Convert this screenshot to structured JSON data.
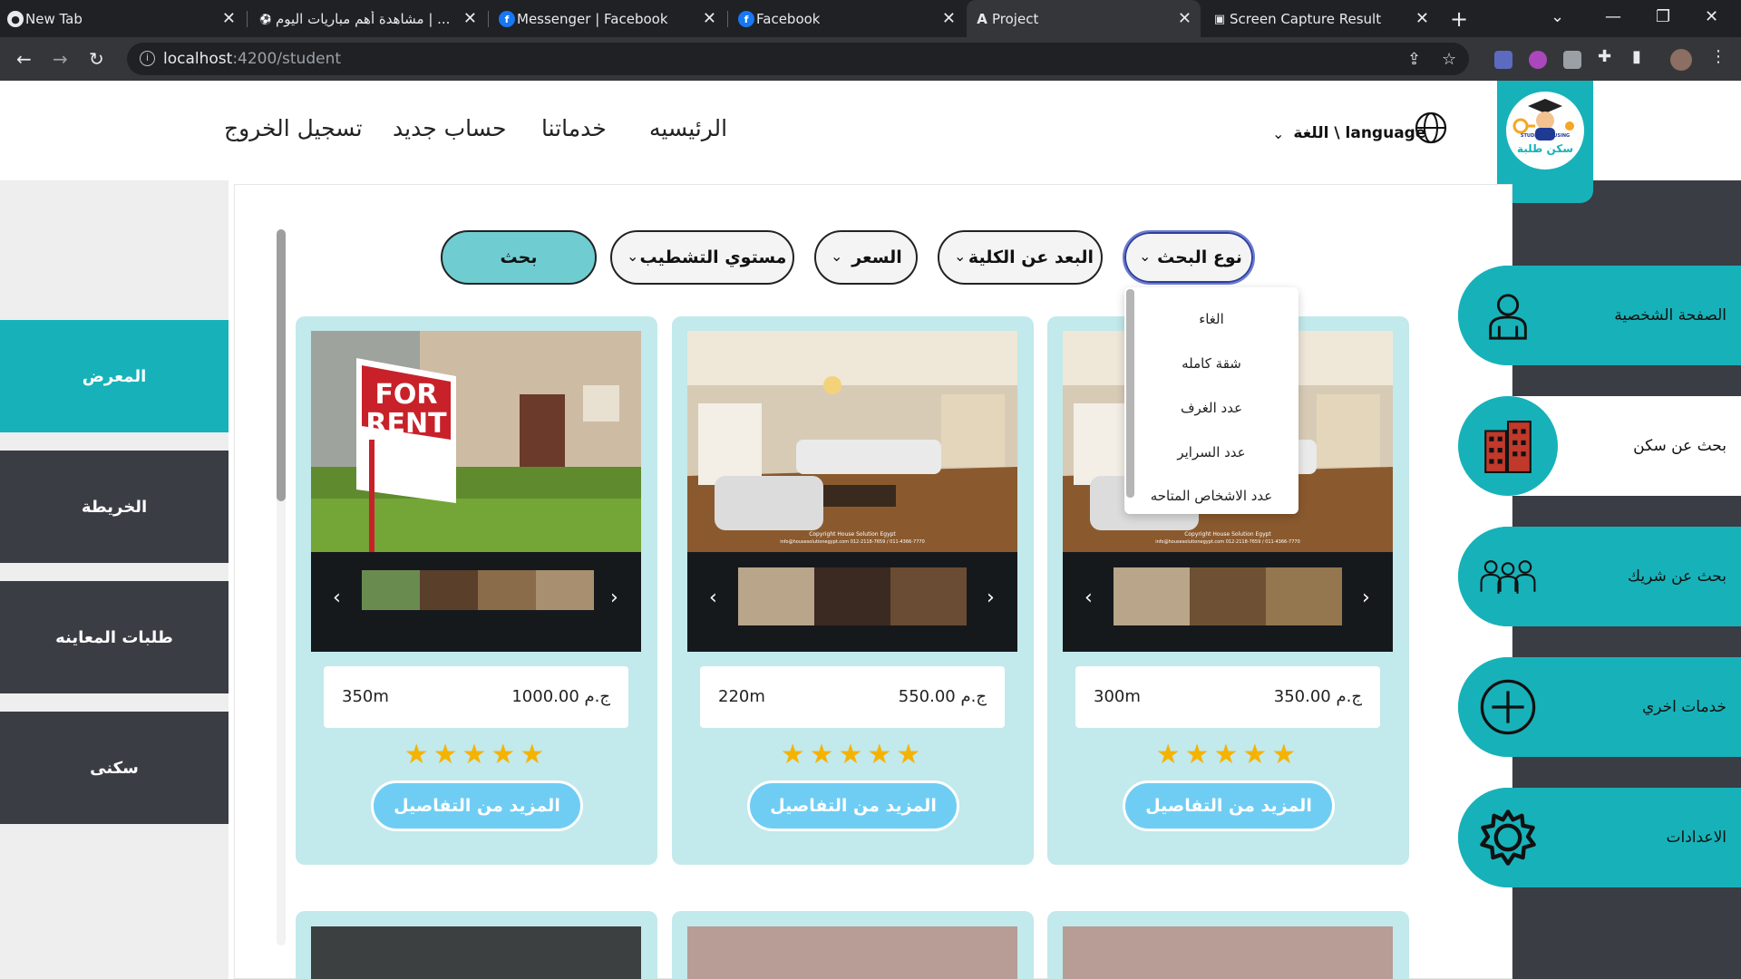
{
  "browser": {
    "tabs": [
      {
        "title": "New Tab"
      },
      {
        "title": "مشاهدة أهم مباريات اليوم | ..."
      },
      {
        "title": "Messenger | Facebook"
      },
      {
        "title": "Facebook"
      },
      {
        "title": "Project"
      },
      {
        "title": "Screen Capture Result"
      }
    ],
    "url_host": "localhost",
    "url_path": ":4200/student"
  },
  "header": {
    "nav": [
      "الرئيسيه",
      "خدماتنا",
      "حساب جديد",
      "تسجيل الخروج"
    ],
    "language_label": "اللغة \\ language",
    "logo_text": "سكن طلبة",
    "logo_badge": "STUDENT HOUSING"
  },
  "left_menu": [
    {
      "label": "المعرض",
      "active": true
    },
    {
      "label": "الخريطة",
      "active": false
    },
    {
      "label": "طلبات المعاينه",
      "active": false
    },
    {
      "label": "سكنى",
      "active": false
    }
  ],
  "right_menu": [
    {
      "label": "الصفحة الشخصية",
      "icon": "user-icon",
      "style": "teal"
    },
    {
      "label": "بحث عن سكن",
      "icon": "building-icon",
      "style": "white"
    },
    {
      "label": "بحث عن شريك",
      "icon": "group-icon",
      "style": "teal"
    },
    {
      "label": "خدمات اخري",
      "icon": "plus-circle-icon",
      "style": "teal"
    },
    {
      "label": "الاعدادات",
      "icon": "gear-icon",
      "style": "teal"
    }
  ],
  "filters": {
    "search_type": "نوع البحث",
    "distance": "البعد عن الكلية",
    "price": "السعر",
    "finish_level": "مستوي التشطيب",
    "search_button": "بحث"
  },
  "dropdown": {
    "options": [
      "الغاء",
      "شقة كامله",
      "عدد الغرف",
      "عدد السراير",
      "عدد الاشخاص المتاحه"
    ]
  },
  "cards": [
    {
      "price": "350.00 ج.م",
      "area": "300m",
      "rating": 5,
      "button": "المزيد من التفاصيل"
    },
    {
      "price": "550.00 ج.م",
      "area": "220m",
      "rating": 5,
      "button": "المزيد من التفاصيل"
    },
    {
      "price": "1000.00 ج.م",
      "area": "350m",
      "rating": 5,
      "button": "المزيد من التفاصيل"
    }
  ],
  "photo_text": {
    "sign_line1": "FOR",
    "sign_line2": "RENT",
    "watermark1": "Copyright House Solution Egypt",
    "watermark2": "info@housesolutionegypt.com 012-2118-7659 / 011-4366-7770"
  },
  "colors": {
    "accent": "#17b2b9",
    "dark": "#3a3d44",
    "card_bg": "#c2e9eb",
    "button": "#6fcdf4",
    "star": "#f5b301"
  }
}
